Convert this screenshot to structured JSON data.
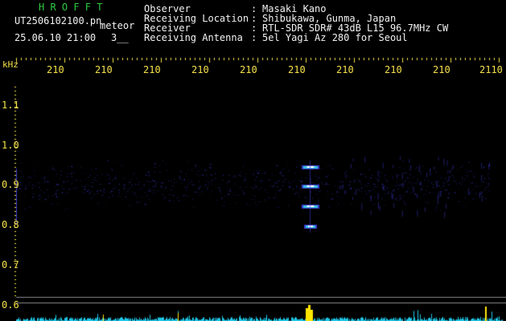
{
  "header": {
    "app_title": "H R O F F T",
    "filename": "UT2506102100.pn",
    "label": "meteor",
    "datetime": "25.06.10 21:00",
    "counter": "3__",
    "fields": [
      {
        "key": "Observer",
        "value": "Masaki Kano"
      },
      {
        "key": "Receiving Location",
        "value": "Shibukawa, Gunma, Japan"
      },
      {
        "key": "Receiver",
        "value": "RTL-SDR SDR# 43dB L15 96.7MHz CW"
      },
      {
        "key": "Receiving Antenna",
        "value": "5el Yagi Az 280 for Seoul"
      }
    ]
  },
  "spectrogram": {
    "y_unit": "kHz",
    "x_ticks": [
      "210",
      "210",
      "210",
      "210",
      "210",
      "210",
      "210",
      "210",
      "210",
      "2110"
    ],
    "y_ticks": [
      "1.1",
      "1.0",
      "0.9",
      "0.8",
      "0.7",
      "0.6"
    ],
    "colors": {
      "text_header": "#f2f2f2",
      "title": "#2ecc40",
      "axis_text": "#f5e14a",
      "noise": "#3b3bd1",
      "echo_core": "#ffffff",
      "echo_mid": "#35c6e0",
      "echo_edge": "#3b3bd1",
      "amplitude": "#1ec8e8",
      "amplitude_peak": "#ffe600"
    }
  }
}
